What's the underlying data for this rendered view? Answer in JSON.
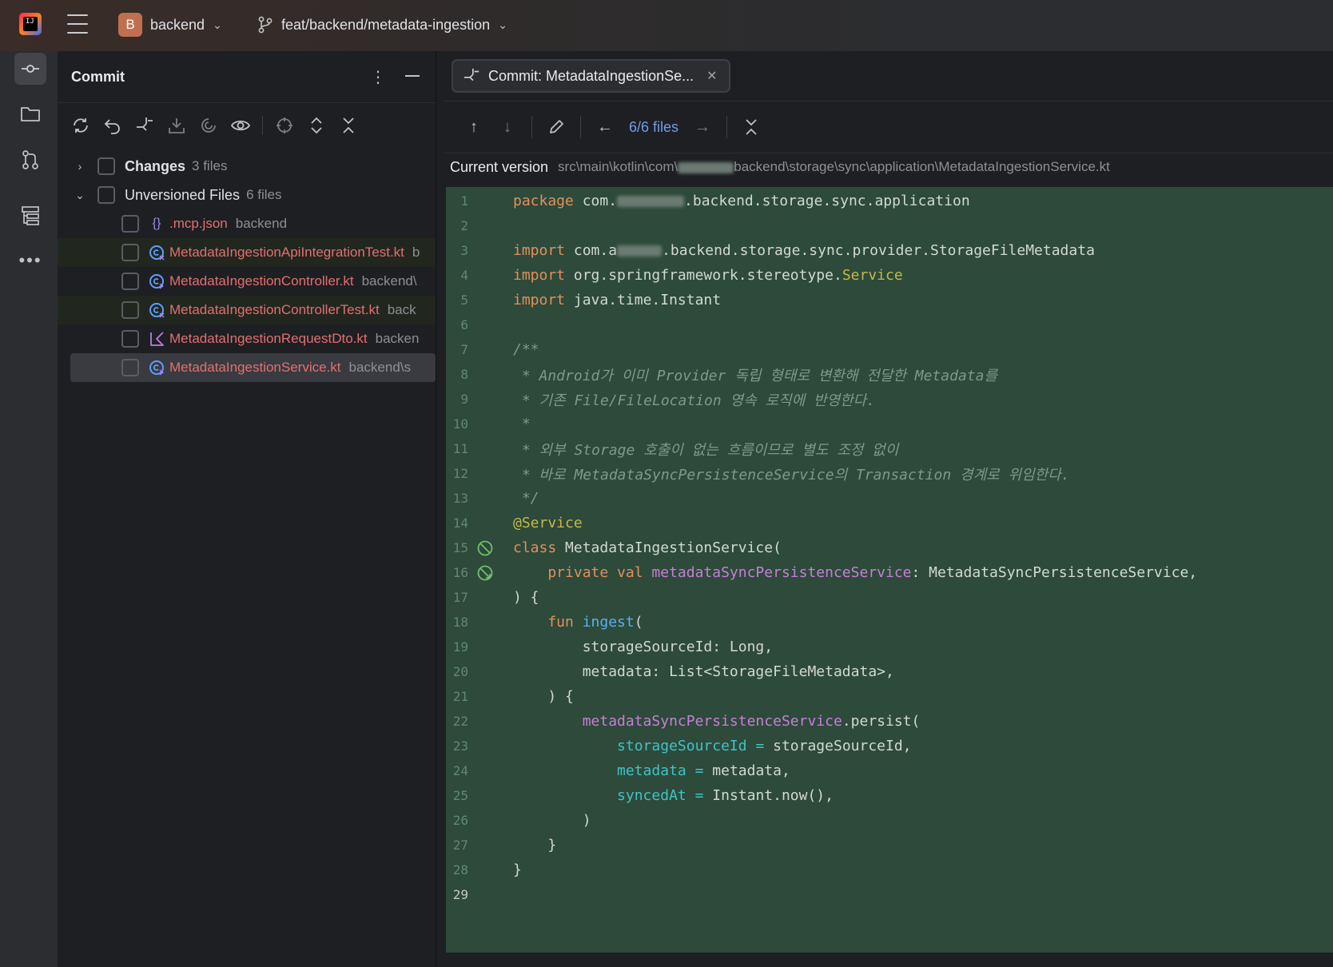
{
  "window": {
    "logo_text": "IJ",
    "project_badge": "B",
    "project_name": "backend",
    "branch_name": "feat/backend/metadata-ingestion"
  },
  "toolstripe": [
    "commit-icon",
    "folder-icon",
    "pull-requests-icon",
    "structure-icon",
    "more-icon"
  ],
  "commit_panel": {
    "title": "Commit",
    "groups": [
      {
        "label": "Changes",
        "count": "3 files",
        "expanded": false
      },
      {
        "label": "Unversioned Files",
        "count": "6 files",
        "expanded": true
      }
    ],
    "files": [
      {
        "name": ".mcp.json",
        "path": "backend",
        "icon": "json-icon"
      },
      {
        "name": "MetadataIngestionApiIntegrationTest.kt",
        "path": "b",
        "icon": "kotlin-test-class-icon"
      },
      {
        "name": "MetadataIngestionController.kt",
        "path": "backend\\",
        "icon": "kotlin-class-icon"
      },
      {
        "name": "MetadataIngestionControllerTest.kt",
        "path": "back",
        "icon": "kotlin-test-class-icon"
      },
      {
        "name": "MetadataIngestionRequestDto.kt",
        "path": "backen",
        "icon": "kotlin-file-icon"
      },
      {
        "name": "MetadataIngestionService.kt",
        "path": "backend\\s",
        "icon": "kotlin-class-icon"
      }
    ]
  },
  "editor": {
    "tab_label": "Commit: MetadataIngestionSe...",
    "files_nav": "6/6 files",
    "version_label": "Current version",
    "version_path": "src\\main\\kotlin\\com\\",
    "version_path_tail": "backend\\storage\\sync\\application\\MetadataIngestionService.kt"
  },
  "code": {
    "line_numbers": [
      "1",
      "2",
      "3",
      "4",
      "5",
      "6",
      "7",
      "8",
      "9",
      "10",
      "11",
      "12",
      "13",
      "14",
      "15",
      "16",
      "17",
      "18",
      "19",
      "20",
      "21",
      "22",
      "23",
      "24",
      "25",
      "26",
      "27",
      "28",
      "29"
    ],
    "l1_kw": "package",
    "l1_a": " com.",
    "l1_b": ".backend.storage.sync.application",
    "l3_kw": "import",
    "l3_a": " com.a",
    "l3_b": ".backend.storage.sync.provider.StorageFileMetadata",
    "l4_kw": "import",
    "l4_a": " org.springframework.stereotype.",
    "l4_b": "Service",
    "l5_kw": "import",
    "l5_a": " java.time.Instant",
    "l7": "/**",
    "l8": " * Android가 이미 Provider 독립 형태로 변환해 전달한 Metadata를",
    "l9": " * 기존 File/FileLocation 영속 로직에 반영한다.",
    "l10": " *",
    "l11": " * 외부 Storage 호출이 없는 흐름이므로 별도 조정 없이",
    "l12": " * 바로 MetadataSyncPersistenceService의 Transaction 경계로 위임한다.",
    "l13": " */",
    "l14": "@Service",
    "l15_kw": "class",
    "l15_a": " MetadataIngestionService(",
    "l16_kw": "    private val ",
    "l16_prop": "metadataSyncPersistenceService",
    "l16_a": ": MetadataSyncPersistenceService,",
    "l17": ") {",
    "l18_kw": "    fun ",
    "l18_fn": "ingest",
    "l18_a": "(",
    "l19": "        storageSourceId: Long,",
    "l20": "        metadata: List<StorageFileMetadata>,",
    "l21": "    ) {",
    "l22_prop": "        metadataSyncPersistenceService",
    "l22_a": ".persist(",
    "l23_param": "            storageSourceId",
    "l23_eq": " = ",
    "l23_a": "storageSourceId,",
    "l24_param": "            metadata",
    "l24_eq": " = ",
    "l24_a": "metadata,",
    "l25_param": "            syncedAt",
    "l25_eq": " = ",
    "l25_a": "Instant.now(),",
    "l26": "        )",
    "l27": "    }",
    "l28": "}"
  },
  "colors": {
    "diff_added_bg": "#2d4a3a",
    "unversioned_file": "#e36f6f",
    "keyword": "#e2905b",
    "annotation": "#c6b84b",
    "function": "#58b0f2",
    "property": "#c87ed8",
    "named_arg": "#41c3c7",
    "link": "#6f9de9"
  }
}
